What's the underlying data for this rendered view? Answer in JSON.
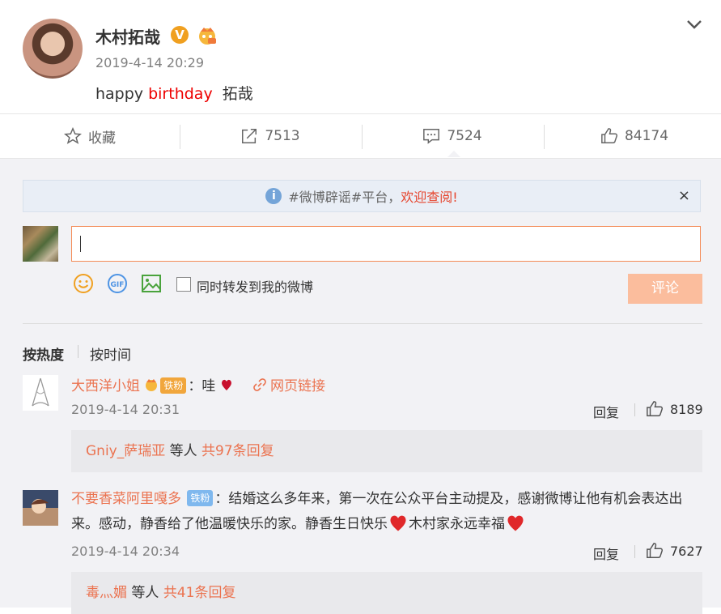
{
  "post": {
    "author": "木村拓哉",
    "verified_badge": "V",
    "time": "2019-4-14 20:29",
    "text_prefix": "happy ",
    "text_highlight": "birthday",
    "text_suffix": "  拓哉"
  },
  "actions": {
    "favorite_label": "收藏",
    "repost_count": "7513",
    "comment_count": "7524",
    "like_count": "84174"
  },
  "notice": {
    "text": "#微博辟谣#平台，",
    "link": "欢迎查阅!",
    "close": "×"
  },
  "composer": {
    "forward_label": "同时转发到我的微博",
    "submit_label": "评论",
    "accent_color": "#fbbd9d"
  },
  "sort": {
    "hot": "按热度",
    "time": "按时间"
  },
  "comments": [
    {
      "user": "大西洋小姐",
      "fan_badge": "铁粉",
      "separator": "：",
      "text": "哇",
      "link": "网页链接",
      "time": "2019-4-14 20:31",
      "reply_label": "回复",
      "likes": "8189",
      "sub_user": "Gniy_萨瑞亚",
      "sub_mid": " 等人 ",
      "sub_count": "共97条回复"
    },
    {
      "user": "不要香菜阿里嘎多",
      "fan_badge": "铁粉",
      "separator": "：",
      "text_1": "结婚这么多年来，第一次在公众平台主动提及，感谢微博让他有机会表达出来。感动，静香给了他温暖快乐的家。静香生日快乐",
      "text_2": "木村家永远幸福",
      "time": "2019-4-14 20:34",
      "reply_label": "回复",
      "likes": "7627",
      "sub_user": "毒灬媚",
      "sub_mid": " 等人 ",
      "sub_count": "共41条回复"
    }
  ],
  "colors": {
    "link_orange": "#eb7350",
    "heart_red": "#e0282a",
    "notice_bg": "#e9eef6"
  }
}
